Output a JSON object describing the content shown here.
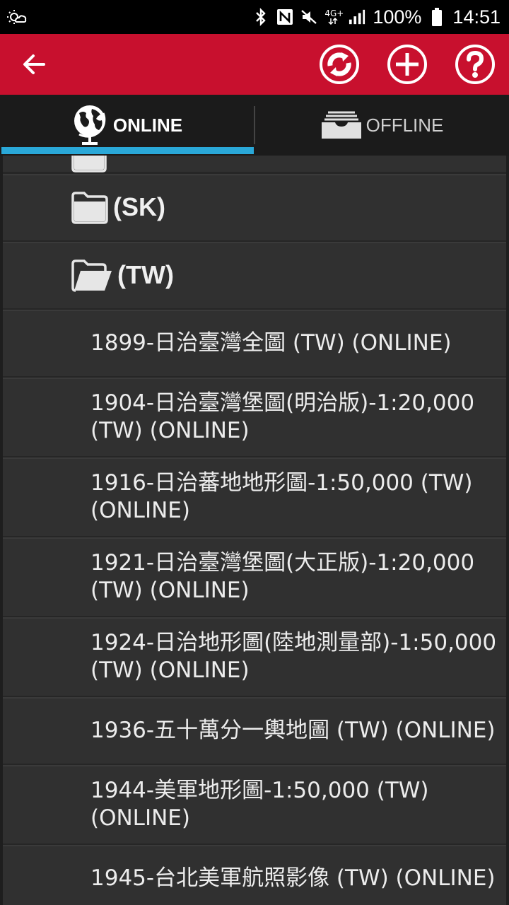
{
  "status_bar": {
    "network": "4G+",
    "battery": "100%",
    "time": "14:51"
  },
  "toolbar": {
    "back_icon": "arrow-left-icon",
    "swap_icon": "refresh-swap-icon",
    "add_icon": "plus-circle-icon",
    "help_icon": "question-circle-icon",
    "color": "#c8102e"
  },
  "tabs": [
    {
      "label": "ONLINE",
      "icon": "globe-icon",
      "selected": true
    },
    {
      "label": "OFFLINE",
      "icon": "tray-stack-icon",
      "selected": false
    }
  ],
  "accent_color": "#2aa8d8",
  "list": {
    "folders": [
      {
        "label": "(SK)",
        "icon": "folder-closed-icon"
      },
      {
        "label": "(TW)",
        "icon": "folder-open-icon"
      }
    ],
    "maps": [
      "1899-日治臺灣全圖 (TW) (ONLINE)",
      "1904-日治臺灣堡圖(明治版)-1:20,000 (TW) (ONLINE)",
      "1916-日治蕃地地形圖-1:50,000 (TW) (ONLINE)",
      "1921-日治臺灣堡圖(大正版)-1:20,000 (TW) (ONLINE)",
      "1924-日治地形圖(陸地測量部)-1:50,000 (TW) (ONLINE)",
      "1936-五十萬分一輿地圖 (TW) (ONLINE)",
      "1944-美軍地形圖-1:50,000 (TW) (ONLINE)",
      "1945-台北美軍航照影像 (TW) (ONLINE)"
    ]
  }
}
